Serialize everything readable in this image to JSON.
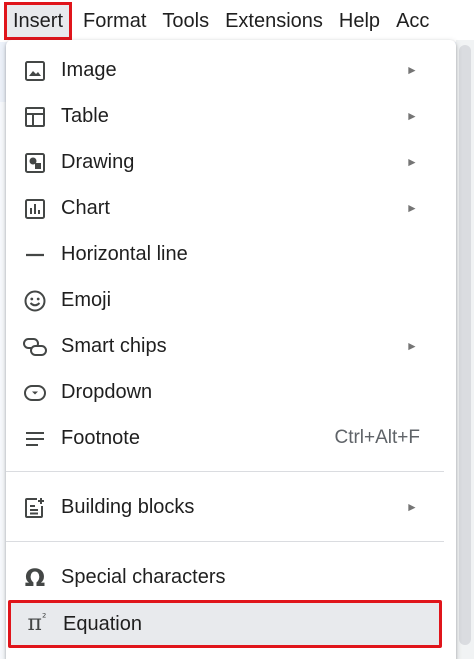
{
  "menubar": {
    "items": [
      "Insert",
      "Format",
      "Tools",
      "Extensions",
      "Help",
      "Acc"
    ]
  },
  "dropdown": {
    "items": [
      {
        "label": "Image",
        "icon": "image-icon",
        "submenu": true
      },
      {
        "label": "Table",
        "icon": "table-icon",
        "submenu": true
      },
      {
        "label": "Drawing",
        "icon": "drawing-icon",
        "submenu": true
      },
      {
        "label": "Chart",
        "icon": "chart-icon",
        "submenu": true
      },
      {
        "label": "Horizontal line",
        "icon": "horizontal-line-icon",
        "submenu": false
      },
      {
        "label": "Emoji",
        "icon": "emoji-icon",
        "submenu": false
      },
      {
        "label": "Smart chips",
        "icon": "smart-chips-icon",
        "submenu": true
      },
      {
        "label": "Dropdown",
        "icon": "dropdown-icon",
        "submenu": false
      },
      {
        "label": "Footnote",
        "icon": "footnote-icon",
        "submenu": false,
        "shortcut": "Ctrl+Alt+F"
      },
      {
        "label": "Building blocks",
        "icon": "building-blocks-icon",
        "submenu": true
      },
      {
        "label": "Special characters",
        "icon": "omega-icon",
        "submenu": false
      },
      {
        "label": "Equation",
        "icon": "pi-squared-icon",
        "submenu": false
      }
    ],
    "arrow_glyph": "►"
  },
  "colors": {
    "highlight_border": "#e0151b",
    "hover_bg": "#e8eaed",
    "icon": "#444746"
  }
}
